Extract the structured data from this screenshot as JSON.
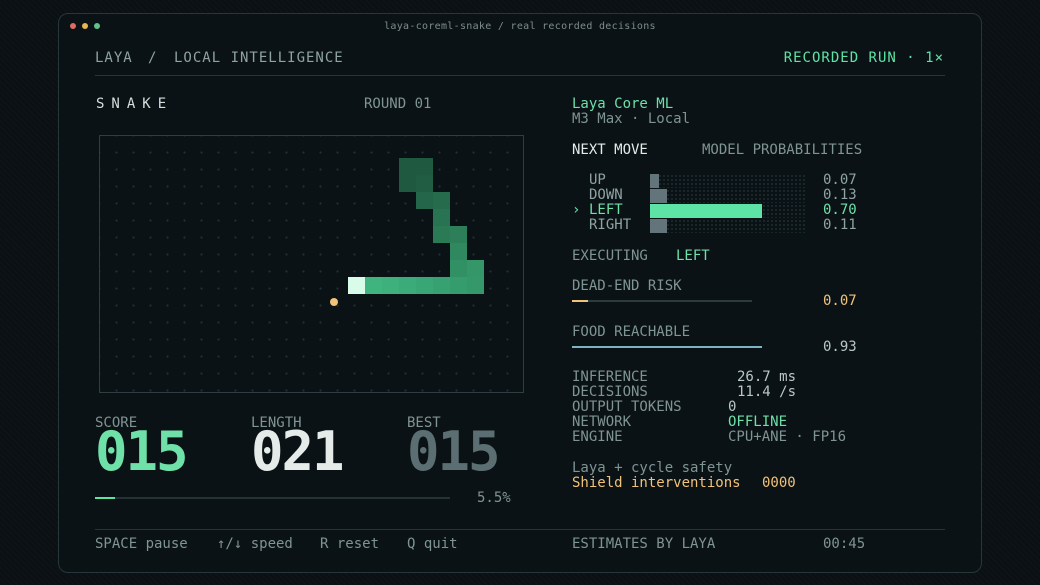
{
  "window": {
    "title": "laya-coreml-snake  /  real recorded decisions",
    "dots": [
      "#e06c5f",
      "#e8b54f",
      "#5fc28c"
    ]
  },
  "header": {
    "brand": "LAYA",
    "sep": "/",
    "section": "LOCAL INTELLIGENCE",
    "run_label": "RECORDED RUN · 1×"
  },
  "game": {
    "title": "SNAKE",
    "round": "ROUND 01",
    "score_label": "SCORE",
    "score": "015",
    "length_label": "LENGTH",
    "length": "021",
    "best_label": "BEST",
    "best": "015",
    "progress": 0.055,
    "progress_text": "5.5%"
  },
  "model": {
    "name": "Laya Core ML",
    "device": "M3 Max · Local",
    "next_move_label": "NEXT MOVE",
    "probs_label": "MODEL PROBABILITIES",
    "moves": [
      {
        "label": "UP",
        "value": "0.07",
        "p": 0.07,
        "selected": false,
        "marker": ""
      },
      {
        "label": "DOWN",
        "value": "0.13",
        "p": 0.13,
        "selected": false,
        "marker": ""
      },
      {
        "label": "LEFT",
        "value": "0.70",
        "p": 0.7,
        "selected": true,
        "marker": "›"
      },
      {
        "label": "RIGHT",
        "value": "0.11",
        "p": 0.11,
        "selected": false,
        "marker": ""
      }
    ],
    "executing_label": "EXECUTING",
    "executing_value": "LEFT",
    "dead_end_label": "DEAD-END RISK",
    "dead_end_value": "0.07",
    "dead_end": 0.07,
    "food_label": "FOOD REACHABLE",
    "food_value": "0.93",
    "food": 0.93
  },
  "stats": {
    "inference_label": "INFERENCE",
    "inference_value": "26.7 ms",
    "decisions_label": "DECISIONS",
    "decisions_value": "11.4 /s",
    "tokens_label": "OUTPUT TOKENS",
    "tokens_value": "0",
    "network_label": "NETWORK",
    "network_value": "OFFLINE",
    "engine_label": "ENGINE",
    "engine_value": "CPU+ANE · FP16"
  },
  "safety": {
    "line1": "Laya + cycle safety",
    "line2_label": "Shield interventions",
    "line2_value": "0000"
  },
  "footer": {
    "pause": "SPACE pause",
    "speed": "↑/↓ speed",
    "reset": "R reset",
    "quit": "Q quit",
    "estimates": "ESTIMATES BY LAYA",
    "time": "00:45"
  },
  "colors": {
    "accent": "#5ee3a6",
    "amber": "#f0c27a",
    "snake_dark": "#1d5b40",
    "snake_bright": "#3fbf86"
  }
}
